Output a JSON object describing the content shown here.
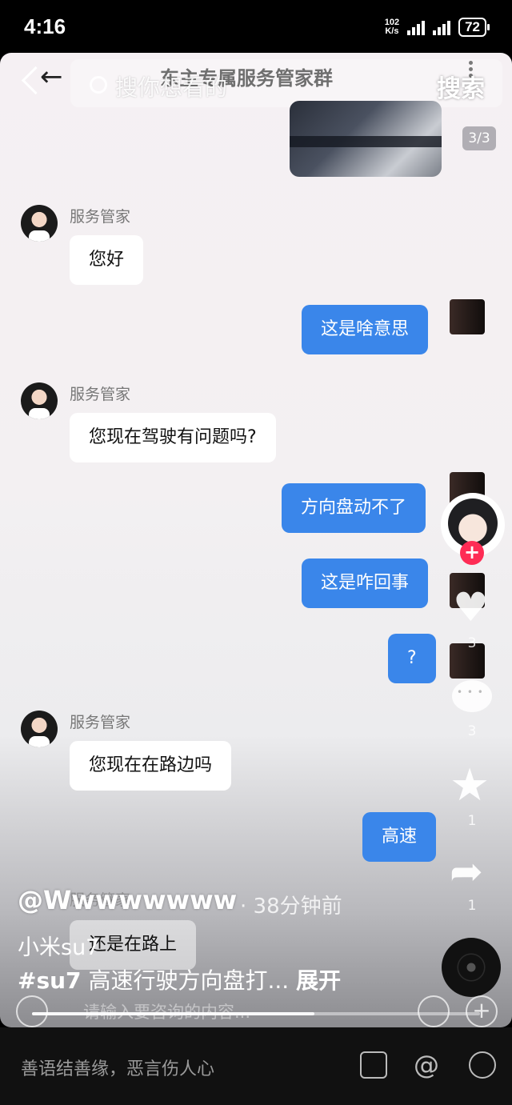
{
  "status_bar": {
    "time": "4:16",
    "net_speed_value": "102",
    "net_speed_unit": "K/s",
    "battery": "72"
  },
  "top_search": {
    "placeholder": "搜你想看的",
    "button": "搜索"
  },
  "chat": {
    "title": "东主专属服务管家群",
    "back": "←",
    "image_counter": "3/3",
    "messages": [
      {
        "sender": "服务管家",
        "text": "您好"
      },
      {
        "text": "这是啥意思"
      },
      {
        "sender": "服务管家",
        "text": "您现在驾驶有问题吗?"
      },
      {
        "text": "方向盘动不了"
      },
      {
        "text": "这是咋回事"
      },
      {
        "text": "?"
      },
      {
        "sender": "服务管家",
        "text": "您现在在路边吗"
      },
      {
        "text": "高速"
      },
      {
        "sender": "服务管家",
        "text": "还是在路上"
      }
    ],
    "input_placeholder": "请输入要咨询的内容..."
  },
  "side": {
    "likes": "3",
    "comments": "3",
    "favorites": "1",
    "shares": "1",
    "follow": "+"
  },
  "post": {
    "author": "@Wwwwwwww",
    "time_ago": "· 38分钟前",
    "line1": "小米su7",
    "hashtag": "#su7",
    "caption": " 高速行驶方向盘打...",
    "expand": "展开",
    "progress_fraction": 0.63
  },
  "bottom_bar": {
    "placeholder": "善语结善缘，恶言伤人心",
    "at": "@"
  }
}
